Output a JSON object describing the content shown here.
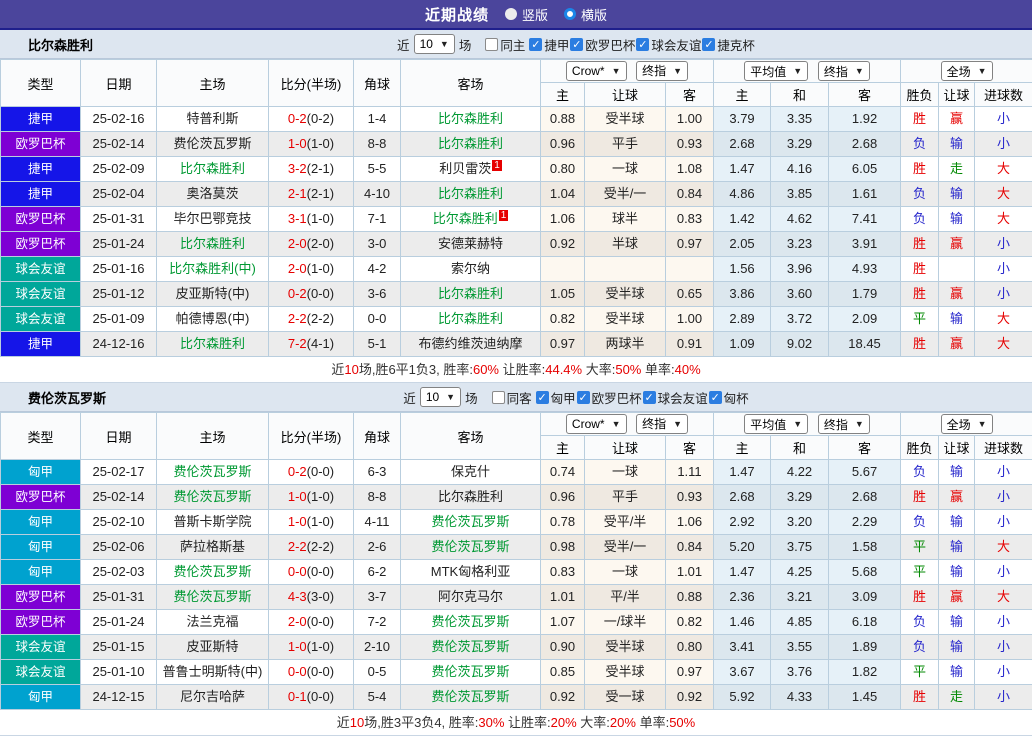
{
  "title_bar": {
    "title": "近期战绩",
    "vertical_label": "竖版",
    "horizontal_label": "横版",
    "selected": "横版"
  },
  "palette": {
    "blue": "#1515e8",
    "purple": "#7e00d4",
    "teal": "#00a79a",
    "cyan": "#00a2cf"
  },
  "result_colors": {
    "r": "#e60000",
    "b": "#2626cc",
    "g": "#008800"
  },
  "accent": {
    "titlebar": "#4b459c",
    "checkbox": "#2b7de1",
    "team_green": "#009933",
    "score_red": "#e60000"
  },
  "tables": [
    {
      "team": "比尔森胜利",
      "filter": {
        "prefix": "近",
        "count": "10",
        "suffix": "场",
        "same_label": "同主",
        "same_checked": false,
        "cups": [
          {
            "label": "捷甲",
            "checked": true
          },
          {
            "label": "欧罗巴杯",
            "checked": true
          },
          {
            "label": "球会友谊",
            "checked": true
          },
          {
            "label": "捷克杯",
            "checked": true
          }
        ]
      },
      "header": {
        "type": "类型",
        "date": "日期",
        "home": "主场",
        "score": "比分(半场)",
        "corner": "角球",
        "away": "客场",
        "odds_source": "Crow*",
        "odds_time": "终指",
        "avg_source": "平均值",
        "avg_time": "终指",
        "scope": "全场",
        "sub": [
          "主",
          "让球",
          "客",
          "主",
          "和",
          "客",
          "胜负",
          "让球",
          "进球数"
        ]
      },
      "rows": [
        {
          "type": "捷甲",
          "tc": "blue",
          "date": "25-02-16",
          "home": "特普利斯",
          "hg": false,
          "hc": false,
          "score": "0-2",
          "half": "(0-2)",
          "corner": "1-4",
          "away": "比尔森胜利",
          "ag": true,
          "ac": false,
          "odds": [
            "0.88",
            "受半球",
            "1.00"
          ],
          "avg": [
            "3.79",
            "3.35",
            "1.92"
          ],
          "res": [
            {
              "t": "胜",
              "c": "r"
            },
            {
              "t": "赢",
              "c": "r"
            },
            {
              "t": "小",
              "c": "b"
            }
          ]
        },
        {
          "type": "欧罗巴杯",
          "tc": "purple",
          "date": "25-02-14",
          "home": "费伦茨瓦罗斯",
          "hg": false,
          "hc": false,
          "score": "1-0",
          "half": "(1-0)",
          "corner": "8-8",
          "away": "比尔森胜利",
          "ag": true,
          "ac": false,
          "odds": [
            "0.96",
            "平手",
            "0.93"
          ],
          "avg": [
            "2.68",
            "3.29",
            "2.68"
          ],
          "res": [
            {
              "t": "负",
              "c": "b"
            },
            {
              "t": "输",
              "c": "b"
            },
            {
              "t": "小",
              "c": "b"
            }
          ]
        },
        {
          "type": "捷甲",
          "tc": "blue",
          "date": "25-02-09",
          "home": "比尔森胜利",
          "hg": true,
          "hc": false,
          "score": "3-2",
          "half": "(2-1)",
          "corner": "5-5",
          "away": "利贝雷茨",
          "ag": false,
          "ac": true,
          "odds": [
            "0.80",
            "一球",
            "1.08"
          ],
          "avg": [
            "1.47",
            "4.16",
            "6.05"
          ],
          "res": [
            {
              "t": "胜",
              "c": "r"
            },
            {
              "t": "走",
              "c": "g"
            },
            {
              "t": "大",
              "c": "r"
            }
          ]
        },
        {
          "type": "捷甲",
          "tc": "blue",
          "date": "25-02-04",
          "home": "奥洛莫茨",
          "hg": false,
          "hc": false,
          "score": "2-1",
          "half": "(2-1)",
          "corner": "4-10",
          "away": "比尔森胜利",
          "ag": true,
          "ac": false,
          "odds": [
            "1.04",
            "受半/一",
            "0.84"
          ],
          "avg": [
            "4.86",
            "3.85",
            "1.61"
          ],
          "res": [
            {
              "t": "负",
              "c": "b"
            },
            {
              "t": "输",
              "c": "b"
            },
            {
              "t": "大",
              "c": "r"
            }
          ]
        },
        {
          "type": "欧罗巴杯",
          "tc": "purple",
          "date": "25-01-31",
          "home": "毕尔巴鄂竞技",
          "hg": false,
          "hc": false,
          "score": "3-1",
          "half": "(1-0)",
          "corner": "7-1",
          "away": "比尔森胜利",
          "ag": true,
          "ac": true,
          "odds": [
            "1.06",
            "球半",
            "0.83"
          ],
          "avg": [
            "1.42",
            "4.62",
            "7.41"
          ],
          "res": [
            {
              "t": "负",
              "c": "b"
            },
            {
              "t": "输",
              "c": "b"
            },
            {
              "t": "大",
              "c": "r"
            }
          ]
        },
        {
          "type": "欧罗巴杯",
          "tc": "purple",
          "date": "25-01-24",
          "home": "比尔森胜利",
          "hg": true,
          "hc": false,
          "score": "2-0",
          "half": "(2-0)",
          "corner": "3-0",
          "away": "安德莱赫特",
          "ag": false,
          "ac": false,
          "odds": [
            "0.92",
            "半球",
            "0.97"
          ],
          "avg": [
            "2.05",
            "3.23",
            "3.91"
          ],
          "res": [
            {
              "t": "胜",
              "c": "r"
            },
            {
              "t": "赢",
              "c": "r"
            },
            {
              "t": "小",
              "c": "b"
            }
          ]
        },
        {
          "type": "球会友谊",
          "tc": "teal",
          "date": "25-01-16",
          "home": "比尔森胜利(中)",
          "hg": true,
          "hc": false,
          "score": "2-0",
          "half": "(1-0)",
          "corner": "4-2",
          "away": "索尔纳",
          "ag": false,
          "ac": false,
          "odds": [
            "",
            "",
            ""
          ],
          "avg": [
            "1.56",
            "3.96",
            "4.93"
          ],
          "res": [
            {
              "t": "胜",
              "c": "r"
            },
            {
              "t": "",
              "c": "b"
            },
            {
              "t": "小",
              "c": "b"
            }
          ]
        },
        {
          "type": "球会友谊",
          "tc": "teal",
          "date": "25-01-12",
          "home": "皮亚斯特(中)",
          "hg": false,
          "hc": false,
          "score": "0-2",
          "half": "(0-0)",
          "corner": "3-6",
          "away": "比尔森胜利",
          "ag": true,
          "ac": false,
          "odds": [
            "1.05",
            "受半球",
            "0.65"
          ],
          "avg": [
            "3.86",
            "3.60",
            "1.79"
          ],
          "res": [
            {
              "t": "胜",
              "c": "r"
            },
            {
              "t": "赢",
              "c": "r"
            },
            {
              "t": "小",
              "c": "b"
            }
          ]
        },
        {
          "type": "球会友谊",
          "tc": "teal",
          "date": "25-01-09",
          "home": "帕德博恩(中)",
          "hg": false,
          "hc": false,
          "score": "2-2",
          "half": "(2-2)",
          "corner": "0-0",
          "away": "比尔森胜利",
          "ag": true,
          "ac": false,
          "odds": [
            "0.82",
            "受半球",
            "1.00"
          ],
          "avg": [
            "2.89",
            "3.72",
            "2.09"
          ],
          "res": [
            {
              "t": "平",
              "c": "g"
            },
            {
              "t": "输",
              "c": "b"
            },
            {
              "t": "大",
              "c": "r"
            }
          ]
        },
        {
          "type": "捷甲",
          "tc": "blue",
          "date": "24-12-16",
          "home": "比尔森胜利",
          "hg": true,
          "hc": false,
          "score": "7-2",
          "half": "(4-1)",
          "corner": "5-1",
          "away": "布德约维茨迪纳摩",
          "ag": false,
          "ac": false,
          "odds": [
            "0.97",
            "两球半",
            "0.91"
          ],
          "avg": [
            "1.09",
            "9.02",
            "18.45"
          ],
          "res": [
            {
              "t": "胜",
              "c": "r"
            },
            {
              "t": "赢",
              "c": "r"
            },
            {
              "t": "大",
              "c": "r"
            }
          ]
        }
      ],
      "footer": [
        {
          "t": "近",
          "c": "k"
        },
        {
          "t": "10",
          "c": "r"
        },
        {
          "t": "场,胜6平1负3, 胜率:",
          "c": "k"
        },
        {
          "t": "60%",
          "c": "r"
        },
        {
          "t": " 让胜率:",
          "c": "k"
        },
        {
          "t": "44.4%",
          "c": "r"
        },
        {
          "t": " 大率:",
          "c": "k"
        },
        {
          "t": "50%",
          "c": "r"
        },
        {
          "t": " 单率:",
          "c": "k"
        },
        {
          "t": "40%",
          "c": "r"
        }
      ]
    },
    {
      "team": "费伦茨瓦罗斯",
      "filter": {
        "prefix": "近",
        "count": "10",
        "suffix": "场",
        "same_label": "同客",
        "same_checked": false,
        "cups": [
          {
            "label": "匈甲",
            "checked": true
          },
          {
            "label": "欧罗巴杯",
            "checked": true
          },
          {
            "label": "球会友谊",
            "checked": true
          },
          {
            "label": "匈杯",
            "checked": true
          }
        ]
      },
      "header": {
        "type": "类型",
        "date": "日期",
        "home": "主场",
        "score": "比分(半场)",
        "corner": "角球",
        "away": "客场",
        "odds_source": "Crow*",
        "odds_time": "终指",
        "avg_source": "平均值",
        "avg_time": "终指",
        "scope": "全场",
        "sub": [
          "主",
          "让球",
          "客",
          "主",
          "和",
          "客",
          "胜负",
          "让球",
          "进球数"
        ]
      },
      "rows": [
        {
          "type": "匈甲",
          "tc": "cyan",
          "date": "25-02-17",
          "home": "费伦茨瓦罗斯",
          "hg": true,
          "hc": false,
          "score": "0-2",
          "half": "(0-0)",
          "corner": "6-3",
          "away": "保克什",
          "ag": false,
          "ac": false,
          "odds": [
            "0.74",
            "一球",
            "1.11"
          ],
          "avg": [
            "1.47",
            "4.22",
            "5.67"
          ],
          "res": [
            {
              "t": "负",
              "c": "b"
            },
            {
              "t": "输",
              "c": "b"
            },
            {
              "t": "小",
              "c": "b"
            }
          ]
        },
        {
          "type": "欧罗巴杯",
          "tc": "purple",
          "date": "25-02-14",
          "home": "费伦茨瓦罗斯",
          "hg": true,
          "hc": false,
          "score": "1-0",
          "half": "(1-0)",
          "corner": "8-8",
          "away": "比尔森胜利",
          "ag": false,
          "ac": false,
          "odds": [
            "0.96",
            "平手",
            "0.93"
          ],
          "avg": [
            "2.68",
            "3.29",
            "2.68"
          ],
          "res": [
            {
              "t": "胜",
              "c": "r"
            },
            {
              "t": "赢",
              "c": "r"
            },
            {
              "t": "小",
              "c": "b"
            }
          ]
        },
        {
          "type": "匈甲",
          "tc": "cyan",
          "date": "25-02-10",
          "home": "普斯卡斯学院",
          "hg": false,
          "hc": false,
          "score": "1-0",
          "half": "(1-0)",
          "corner": "4-11",
          "away": "费伦茨瓦罗斯",
          "ag": true,
          "ac": false,
          "odds": [
            "0.78",
            "受平/半",
            "1.06"
          ],
          "avg": [
            "2.92",
            "3.20",
            "2.29"
          ],
          "res": [
            {
              "t": "负",
              "c": "b"
            },
            {
              "t": "输",
              "c": "b"
            },
            {
              "t": "小",
              "c": "b"
            }
          ]
        },
        {
          "type": "匈甲",
          "tc": "cyan",
          "date": "25-02-06",
          "home": "萨拉格斯基",
          "hg": false,
          "hc": false,
          "score": "2-2",
          "half": "(2-2)",
          "corner": "2-6",
          "away": "费伦茨瓦罗斯",
          "ag": true,
          "ac": false,
          "odds": [
            "0.98",
            "受半/一",
            "0.84"
          ],
          "avg": [
            "5.20",
            "3.75",
            "1.58"
          ],
          "res": [
            {
              "t": "平",
              "c": "g"
            },
            {
              "t": "输",
              "c": "b"
            },
            {
              "t": "大",
              "c": "r"
            }
          ]
        },
        {
          "type": "匈甲",
          "tc": "cyan",
          "date": "25-02-03",
          "home": "费伦茨瓦罗斯",
          "hg": true,
          "hc": false,
          "score": "0-0",
          "half": "(0-0)",
          "corner": "6-2",
          "away": "MTK匈格利亚",
          "ag": false,
          "ac": false,
          "odds": [
            "0.83",
            "一球",
            "1.01"
          ],
          "avg": [
            "1.47",
            "4.25",
            "5.68"
          ],
          "res": [
            {
              "t": "平",
              "c": "g"
            },
            {
              "t": "输",
              "c": "b"
            },
            {
              "t": "小",
              "c": "b"
            }
          ]
        },
        {
          "type": "欧罗巴杯",
          "tc": "purple",
          "date": "25-01-31",
          "home": "费伦茨瓦罗斯",
          "hg": true,
          "hc": false,
          "score": "4-3",
          "half": "(3-0)",
          "corner": "3-7",
          "away": "阿尔克马尔",
          "ag": false,
          "ac": false,
          "odds": [
            "1.01",
            "平/半",
            "0.88"
          ],
          "avg": [
            "2.36",
            "3.21",
            "3.09"
          ],
          "res": [
            {
              "t": "胜",
              "c": "r"
            },
            {
              "t": "赢",
              "c": "r"
            },
            {
              "t": "大",
              "c": "r"
            }
          ]
        },
        {
          "type": "欧罗巴杯",
          "tc": "purple",
          "date": "25-01-24",
          "home": "法兰克福",
          "hg": false,
          "hc": false,
          "score": "2-0",
          "half": "(0-0)",
          "corner": "7-2",
          "away": "费伦茨瓦罗斯",
          "ag": true,
          "ac": false,
          "odds": [
            "1.07",
            "一/球半",
            "0.82"
          ],
          "avg": [
            "1.46",
            "4.85",
            "6.18"
          ],
          "res": [
            {
              "t": "负",
              "c": "b"
            },
            {
              "t": "输",
              "c": "b"
            },
            {
              "t": "小",
              "c": "b"
            }
          ]
        },
        {
          "type": "球会友谊",
          "tc": "teal",
          "date": "25-01-15",
          "home": "皮亚斯特",
          "hg": false,
          "hc": false,
          "score": "1-0",
          "half": "(1-0)",
          "corner": "2-10",
          "away": "费伦茨瓦罗斯",
          "ag": true,
          "ac": false,
          "odds": [
            "0.90",
            "受半球",
            "0.80"
          ],
          "avg": [
            "3.41",
            "3.55",
            "1.89"
          ],
          "res": [
            {
              "t": "负",
              "c": "b"
            },
            {
              "t": "输",
              "c": "b"
            },
            {
              "t": "小",
              "c": "b"
            }
          ]
        },
        {
          "type": "球会友谊",
          "tc": "teal",
          "date": "25-01-10",
          "home": "普鲁士明斯特(中)",
          "hg": false,
          "hc": false,
          "score": "0-0",
          "half": "(0-0)",
          "corner": "0-5",
          "away": "费伦茨瓦罗斯",
          "ag": true,
          "ac": false,
          "odds": [
            "0.85",
            "受半球",
            "0.97"
          ],
          "avg": [
            "3.67",
            "3.76",
            "1.82"
          ],
          "res": [
            {
              "t": "平",
              "c": "g"
            },
            {
              "t": "输",
              "c": "b"
            },
            {
              "t": "小",
              "c": "b"
            }
          ]
        },
        {
          "type": "匈甲",
          "tc": "cyan",
          "date": "24-12-15",
          "home": "尼尔吉哈萨",
          "hg": false,
          "hc": false,
          "score": "0-1",
          "half": "(0-0)",
          "corner": "5-4",
          "away": "费伦茨瓦罗斯",
          "ag": true,
          "ac": false,
          "odds": [
            "0.92",
            "受一球",
            "0.92"
          ],
          "avg": [
            "5.92",
            "4.33",
            "1.45"
          ],
          "res": [
            {
              "t": "胜",
              "c": "r"
            },
            {
              "t": "走",
              "c": "g"
            },
            {
              "t": "小",
              "c": "b"
            }
          ]
        }
      ],
      "footer": [
        {
          "t": "近",
          "c": "k"
        },
        {
          "t": "10",
          "c": "r"
        },
        {
          "t": "场,胜3平3负4, 胜率:",
          "c": "k"
        },
        {
          "t": "30%",
          "c": "r"
        },
        {
          "t": " 让胜率:",
          "c": "k"
        },
        {
          "t": "20%",
          "c": "r"
        },
        {
          "t": " 大率:",
          "c": "k"
        },
        {
          "t": "20%",
          "c": "r"
        },
        {
          "t": " 单率:",
          "c": "k"
        },
        {
          "t": "50%",
          "c": "r"
        }
      ]
    }
  ]
}
